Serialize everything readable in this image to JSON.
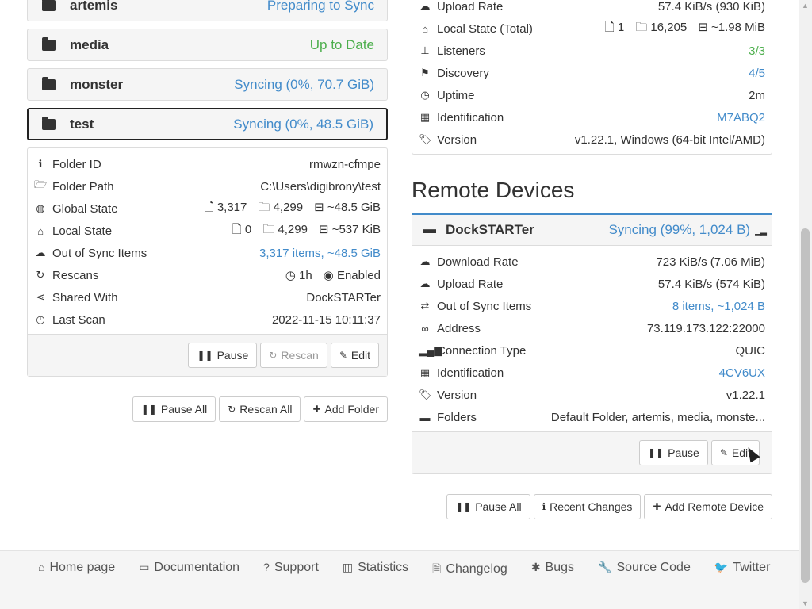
{
  "folders": {
    "items": [
      {
        "name": "artemis",
        "status": "Preparing to Sync",
        "color": "blue"
      },
      {
        "name": "media",
        "status": "Up to Date",
        "color": "green"
      },
      {
        "name": "monster",
        "status": "Syncing (0%, 70.7 GiB)",
        "color": "blue"
      },
      {
        "name": "test",
        "status": "Syncing (0%, 48.5 GiB)",
        "color": "blue"
      }
    ],
    "test_details": {
      "folder_id_label": "Folder ID",
      "folder_id": "rmwzn-cfmpe",
      "folder_path_label": "Folder Path",
      "folder_path": "C:\\Users\\digibrony\\test",
      "global_state_label": "Global State",
      "global_files": "3,317",
      "global_dirs": "4,299",
      "global_size": "~48.5 GiB",
      "local_state_label": "Local State",
      "local_files": "0",
      "local_dirs": "4,299",
      "local_size": "~537 KiB",
      "out_of_sync_label": "Out of Sync Items",
      "out_of_sync": "3,317 items, ~48.5 GiB",
      "rescans_label": "Rescans",
      "rescan_interval": "1h",
      "watcher": "Enabled",
      "shared_with_label": "Shared With",
      "shared_with": "DockSTARTer",
      "last_scan_label": "Last Scan",
      "last_scan": "2022-11-15 10:11:37",
      "pause_button": "Pause",
      "rescan_button": "Rescan",
      "edit_button": "Edit"
    },
    "pause_all": "Pause All",
    "rescan_all": "Rescan All",
    "add_folder": "Add Folder"
  },
  "this_device": {
    "upload_rate_label": "Upload Rate",
    "upload_rate": "57.4 KiB/s (930 KiB)",
    "local_state_label": "Local State (Total)",
    "local_files": "1",
    "local_dirs": "16,205",
    "local_size": "~1.98 MiB",
    "listeners_label": "Listeners",
    "listeners": "3/3",
    "discovery_label": "Discovery",
    "discovery": "4/5",
    "uptime_label": "Uptime",
    "uptime": "2m",
    "identification_label": "Identification",
    "identification": "M7ABQ2",
    "version_label": "Version",
    "version": "v1.22.1, Windows (64-bit Intel/AMD)"
  },
  "remote": {
    "heading": "Remote Devices",
    "device": {
      "name": "DockSTARTer",
      "status": "Syncing (99%, 1,024 B)",
      "download_rate_label": "Download Rate",
      "download_rate": "723 KiB/s (7.06 MiB)",
      "upload_rate_label": "Upload Rate",
      "upload_rate": "57.4 KiB/s (574 KiB)",
      "out_of_sync_label": "Out of Sync Items",
      "out_of_sync": "8 items, ~1,024 B",
      "address_label": "Address",
      "address": "73.119.173.122:22000",
      "connection_type_label": "Connection Type",
      "connection_type": "QUIC",
      "identification_label": "Identification",
      "identification": "4CV6UX",
      "version_label": "Version",
      "version": "v1.22.1",
      "folders_label": "Folders",
      "folders": "Default Folder, artemis, media, monste...",
      "pause_button": "Pause",
      "edit_button": "Edit"
    },
    "pause_all": "Pause All",
    "recent_changes": "Recent Changes",
    "add_remote_device": "Add Remote Device"
  },
  "footer": {
    "home_page": "Home page",
    "documentation": "Documentation",
    "support": "Support",
    "statistics": "Statistics",
    "changelog": "Changelog",
    "bugs": "Bugs",
    "source_code": "Source Code",
    "twitter": "Twitter"
  },
  "colors": {
    "link_blue": "#428bca",
    "up_to_date_green": "#4cae4c",
    "panel_bg": "#f5f5f5"
  }
}
